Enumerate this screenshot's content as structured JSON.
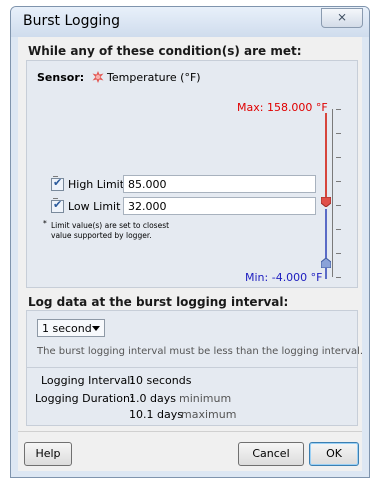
{
  "window": {
    "title": "Burst Logging",
    "close_label": "⨯"
  },
  "conditions": {
    "heading": "While any of these condition(s) are met:",
    "sensor_prefix": "Sensor:",
    "sensor_name": "Temperature (°F)",
    "max_label": "Max: 158.000 °F",
    "min_label": "Min: -4.000 °F",
    "high_limit": {
      "label": "High Limit",
      "checked": true,
      "value": "85.000"
    },
    "low_limit": {
      "label": "Low Limit",
      "checked": true,
      "value": "32.000"
    },
    "note_line1": "Limit value(s) are set to closest",
    "note_line2": "value supported by logger.",
    "note_bullet": "*",
    "colors": {
      "max": "#e00000",
      "min": "#2020c0",
      "high_thumb": "#e0504a",
      "low_thumb": "#8aa2d8"
    }
  },
  "interval": {
    "heading": "Log data at the burst logging interval:",
    "selected": "1 second",
    "hint": "The burst logging interval must be less than the logging interval.",
    "logging_interval_label": "Logging Interval:",
    "logging_interval_value": "10 seconds",
    "logging_duration_label": "Logging Duration:",
    "duration_min_value": "1.0 days",
    "duration_min_suffix": "minimum",
    "duration_max_value": "10.1 days",
    "duration_max_suffix": "maximum"
  },
  "buttons": {
    "help": "Help",
    "cancel": "Cancel",
    "ok": "OK"
  }
}
